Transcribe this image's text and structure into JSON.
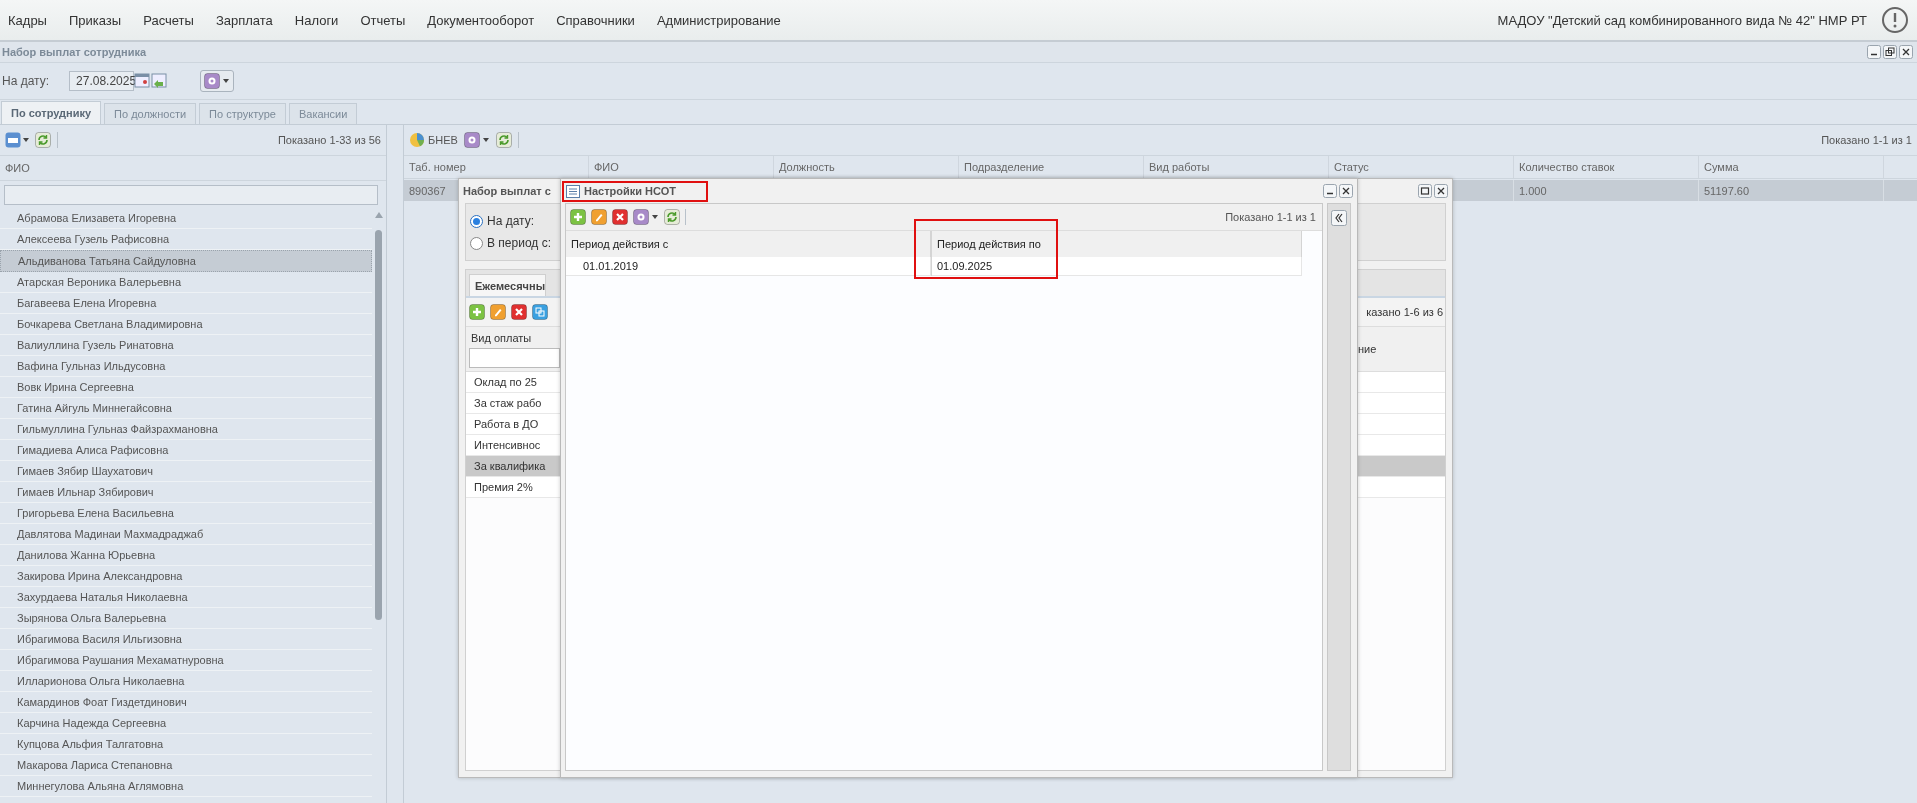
{
  "menu": {
    "items": [
      "Кадры",
      "Приказы",
      "Расчеты",
      "Зарплата",
      "Налоги",
      "Отчеты",
      "Документооборот",
      "Справочники",
      "Администрирование"
    ],
    "organization": "МАДОУ \"Детский сад комбинированного вида № 42\" НМР РТ"
  },
  "window": {
    "title": "Набор выплат сотрудника"
  },
  "date_filter": {
    "label": "На дату:",
    "value": "27.08.2025"
  },
  "tabs": [
    {
      "label": "По сотруднику",
      "selected": true
    },
    {
      "label": "По должности",
      "selected": false
    },
    {
      "label": "По структуре",
      "selected": false
    },
    {
      "label": "Вакансии",
      "selected": false
    }
  ],
  "employees": {
    "paging": "Показано 1-33 из 56",
    "column": "ФИО",
    "rows": [
      {
        "name": "Абрамова Елизавета Игоревна",
        "selected": false
      },
      {
        "name": "Алексеева Гузель Рафисовна",
        "selected": false
      },
      {
        "name": "Альдиванова Татьяна Сайдуловна",
        "selected": true
      },
      {
        "name": "Атарская Вероника Валерьевна",
        "selected": false
      },
      {
        "name": "Багавеева Елена Игоревна",
        "selected": false
      },
      {
        "name": "Бочкарева Светлана Владимировна",
        "selected": false
      },
      {
        "name": "Валиуллина Гузель Ринатовна",
        "selected": false
      },
      {
        "name": "Вафина Гульназ Ильдусовна",
        "selected": false
      },
      {
        "name": "Вовк Ирина Сергеевна",
        "selected": false
      },
      {
        "name": "Гатина Айгуль Миннегайсовна",
        "selected": false
      },
      {
        "name": "Гильмуллина Гульназ Файзрахмановна",
        "selected": false
      },
      {
        "name": "Гимадиева Алиса Рафисовна",
        "selected": false
      },
      {
        "name": "Гимаев Зябир Шаухатович",
        "selected": false
      },
      {
        "name": "Гимаев Ильнар Зябирович",
        "selected": false
      },
      {
        "name": "Григорьева Елена Васильевна",
        "selected": false
      },
      {
        "name": "Давлятова Мадинаи Махмадраджаб",
        "selected": false
      },
      {
        "name": "Данилова Жанна Юрьевна",
        "selected": false
      },
      {
        "name": "Закирова Ирина Александровна",
        "selected": false
      },
      {
        "name": "Захурдаева Наталья Николаевна",
        "selected": false
      },
      {
        "name": "Зырянова Ольга Валерьевна",
        "selected": false
      },
      {
        "name": "Ибрагимова Василя Ильгизовна",
        "selected": false
      },
      {
        "name": "Ибрагимова Раушания Мехаматнуровна",
        "selected": false
      },
      {
        "name": "Илларионова Ольга Николаевна",
        "selected": false
      },
      {
        "name": "Камардинов Фоат Гиздетдинович",
        "selected": false
      },
      {
        "name": "Карчина Надежда Сергеевна",
        "selected": false
      },
      {
        "name": "Купцова Альфия Талгатовна",
        "selected": false
      },
      {
        "name": "Макарова Лариса Степановна",
        "selected": false
      },
      {
        "name": "Миннегулова Альяна Аглямовна",
        "selected": false
      }
    ]
  },
  "assignments": {
    "toolbar_label": "БНЕВ",
    "paging": "Показано 1-1 из 1",
    "columns": [
      "Таб. номер",
      "ФИО",
      "Должность",
      "Подразделение",
      "Вид работы",
      "Статус",
      "Количество ставок",
      "Сумма"
    ],
    "rows": [
      {
        "tab_number": "890367",
        "rate_count": "1.000",
        "amount": "51197.60",
        "selected": true
      }
    ]
  },
  "payments_dialog": {
    "title": "Набор выплат с",
    "options": [
      {
        "label": "На дату:",
        "selected": true
      },
      {
        "label": "В период с:",
        "selected": false
      }
    ],
    "tab": "Ежемесячны",
    "column": "Вид оплаты",
    "paging": "казано 1-6 из 6",
    "column_2": "ние",
    "rows": [
      {
        "label": "Оклад по 25",
        "selected": false
      },
      {
        "label": "За стаж рабо",
        "selected": false
      },
      {
        "label": "Работа в ДО",
        "selected": false
      },
      {
        "label": "Интенсивнос",
        "selected": false
      },
      {
        "label": "За квалифика",
        "selected": true
      },
      {
        "label": "Премия 2%",
        "selected": false
      }
    ]
  },
  "settings_dialog": {
    "title": {
      "text": "Настройки НСОТ",
      "highlighted": true
    },
    "paging": "Показано 1-1 из 1",
    "columns": [
      {
        "label": "Период действия с",
        "highlighted": false,
        "cells": [
          "01.01.2019"
        ]
      },
      {
        "label": "Период действия по",
        "highlighted": true,
        "cells": [
          "01.09.2025"
        ]
      }
    ]
  }
}
